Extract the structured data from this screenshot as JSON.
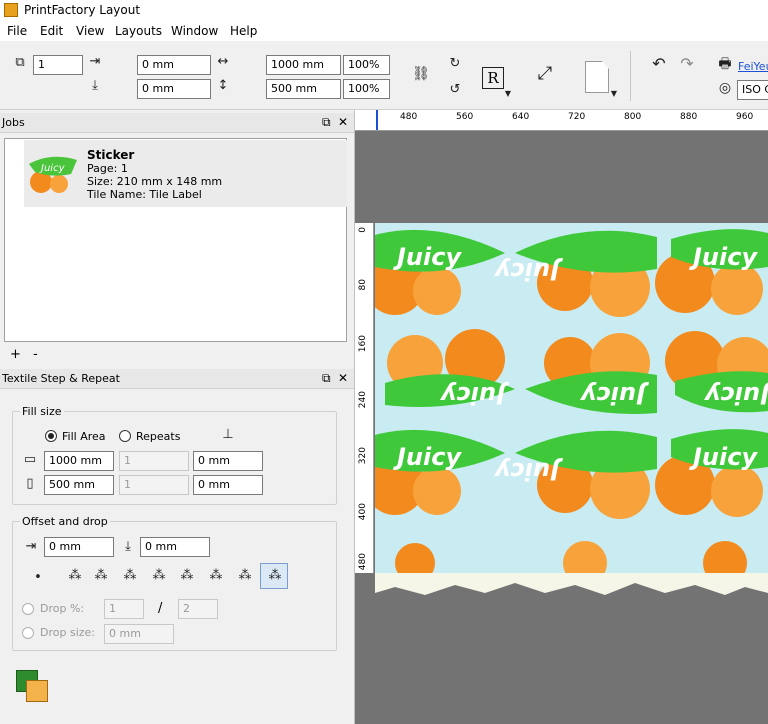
{
  "app": {
    "title": "PrintFactory Layout"
  },
  "menu": [
    "File",
    "Edit",
    "View",
    "Layouts",
    "Window",
    "Help"
  ],
  "toolbar": {
    "copies": "1",
    "h_offset": "0 mm",
    "v_offset": "0 mm",
    "width": "1000 mm",
    "width_pct": "100%",
    "height": "500 mm",
    "height_pct": "100%",
    "printer_name": "FeiYeu",
    "profile": "ISO C"
  },
  "jobs_panel": {
    "title": "Jobs",
    "job": {
      "name": "Sticker",
      "page": "Page: 1",
      "size": "Size: 210 mm x 148 mm",
      "tile": "Tile Name: Tile Label",
      "thumb_text": "Juicy"
    },
    "add": "+",
    "remove": "-"
  },
  "step_repeat": {
    "title": "Textile Step & Repeat",
    "fill_size_label": "Fill size",
    "fill_area": "Fill Area",
    "repeats": "Repeats",
    "width": "1000 mm",
    "width_repeats": "1",
    "width_gap": "0 mm",
    "height": "500 mm",
    "height_repeats": "1",
    "height_gap": "0 mm",
    "offset_label": "Offset and drop",
    "offset_h": "0 mm",
    "offset_v": "0 mm",
    "drop_pct_label": "Drop %:",
    "drop_num": "1",
    "drop_sep": "/",
    "drop_den": "2",
    "drop_size_label": "Drop size:",
    "drop_size": "0 mm"
  },
  "ruler": {
    "h_ticks": [
      "480",
      "560",
      "640",
      "720",
      "800",
      "880",
      "960"
    ],
    "v_ticks": [
      "0",
      "80",
      "160",
      "240",
      "320",
      "400",
      "480"
    ]
  },
  "tile": {
    "text": "Juicy",
    "bg_color": "#c8ecf2",
    "leaf_color": "#3fc93a"
  }
}
